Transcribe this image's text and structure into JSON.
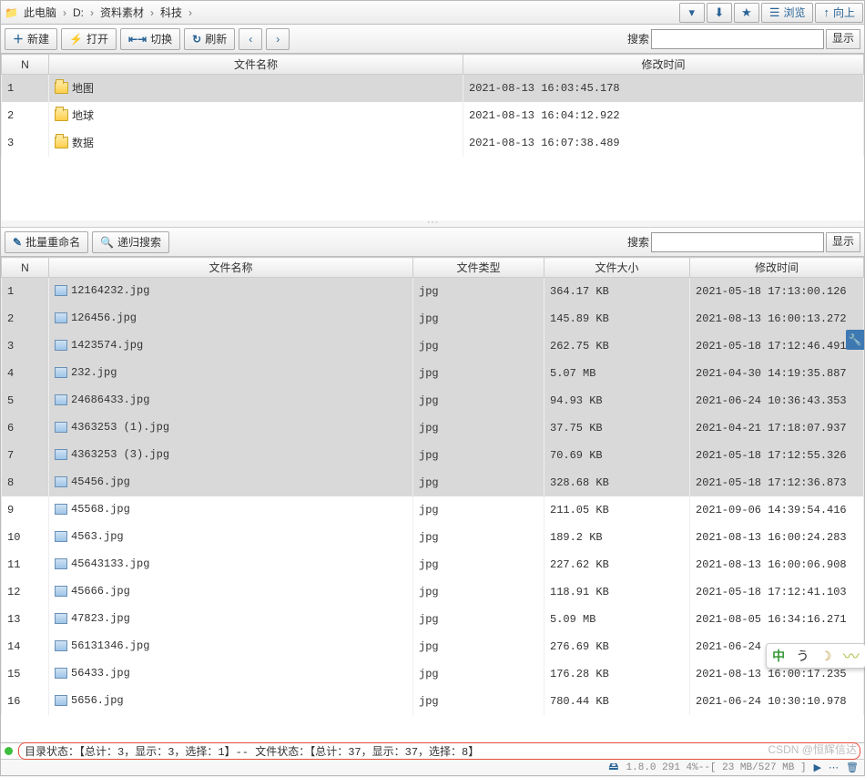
{
  "breadcrumb": {
    "root": "此电脑",
    "items": [
      "D:",
      "资料素材",
      "科技"
    ]
  },
  "nav": {
    "down_icon": "▾",
    "circle_down": "⬇",
    "star": "★",
    "list_icon": "☰",
    "browse": "浏览",
    "up_icon": "↑",
    "up": "向上"
  },
  "toolbar1": {
    "new_icon": "＋",
    "new": "新建",
    "open_icon": "⚡",
    "open": "打开",
    "switch_icon": "⇤⇥",
    "switch": "切换",
    "refresh_icon": "↻",
    "refresh": "刷新",
    "prev": "‹",
    "next": "›",
    "search_label": "搜索",
    "display": "显示"
  },
  "upper": {
    "cols": {
      "n": "N",
      "name": "文件名称",
      "time": "修改时间"
    },
    "rows": [
      {
        "n": "1",
        "name": "地图",
        "time": "2021-08-13 16:03:45.178",
        "sel": true
      },
      {
        "n": "2",
        "name": "地球",
        "time": "2021-08-13 16:04:12.922",
        "sel": false
      },
      {
        "n": "3",
        "name": "数据",
        "time": "2021-08-13 16:07:38.489",
        "sel": false
      }
    ]
  },
  "toolbar2": {
    "rename_icon": "✎",
    "rename": "批量重命名",
    "rsearch_icon": "🔍",
    "rsearch": "递归搜索",
    "search_label": "搜索",
    "display": "显示"
  },
  "lower": {
    "cols": {
      "n": "N",
      "name": "文件名称",
      "type": "文件类型",
      "size": "文件大小",
      "time": "修改时间"
    },
    "rows": [
      {
        "n": "1",
        "name": "12164232.jpg",
        "type": "jpg",
        "size": "364.17 KB",
        "time": "2021-05-18 17:13:00.126",
        "sel": true
      },
      {
        "n": "2",
        "name": "126456.jpg",
        "type": "jpg",
        "size": "145.89 KB",
        "time": "2021-08-13 16:00:13.272",
        "sel": true
      },
      {
        "n": "3",
        "name": "1423574.jpg",
        "type": "jpg",
        "size": "262.75 KB",
        "time": "2021-05-18 17:12:46.491",
        "sel": true
      },
      {
        "n": "4",
        "name": "232.jpg",
        "type": "jpg",
        "size": "5.07 MB",
        "time": "2021-04-30 14:19:35.887",
        "sel": true
      },
      {
        "n": "5",
        "name": "24686433.jpg",
        "type": "jpg",
        "size": "94.93 KB",
        "time": "2021-06-24 10:36:43.353",
        "sel": true
      },
      {
        "n": "6",
        "name": "4363253 (1).jpg",
        "type": "jpg",
        "size": "37.75 KB",
        "time": "2021-04-21 17:18:07.937",
        "sel": true
      },
      {
        "n": "7",
        "name": "4363253 (3).jpg",
        "type": "jpg",
        "size": "70.69 KB",
        "time": "2021-05-18 17:12:55.326",
        "sel": true
      },
      {
        "n": "8",
        "name": "45456.jpg",
        "type": "jpg",
        "size": "328.68 KB",
        "time": "2021-05-18 17:12:36.873",
        "sel": true
      },
      {
        "n": "9",
        "name": "45568.jpg",
        "type": "jpg",
        "size": "211.05 KB",
        "time": "2021-09-06 14:39:54.416",
        "sel": false
      },
      {
        "n": "10",
        "name": "4563.jpg",
        "type": "jpg",
        "size": "189.2 KB",
        "time": "2021-08-13 16:00:24.283",
        "sel": false
      },
      {
        "n": "11",
        "name": "45643133.jpg",
        "type": "jpg",
        "size": "227.62 KB",
        "time": "2021-08-13 16:00:06.908",
        "sel": false
      },
      {
        "n": "12",
        "name": "45666.jpg",
        "type": "jpg",
        "size": "118.91 KB",
        "time": "2021-05-18 17:12:41.103",
        "sel": false
      },
      {
        "n": "13",
        "name": "47823.jpg",
        "type": "jpg",
        "size": "5.09 MB",
        "time": "2021-08-05 16:34:16.271",
        "sel": false
      },
      {
        "n": "14",
        "name": "56131346.jpg",
        "type": "jpg",
        "size": "276.69 KB",
        "time": "2021-06-24",
        "sel": false
      },
      {
        "n": "15",
        "name": "56433.jpg",
        "type": "jpg",
        "size": "176.28 KB",
        "time": "2021-08-13 16:00:17.235",
        "sel": false
      },
      {
        "n": "16",
        "name": "5656.jpg",
        "type": "jpg",
        "size": "780.44 KB",
        "time": "2021-06-24 10:30:10.978",
        "sel": false
      }
    ]
  },
  "side_tool": "🔧",
  "status": "目录状态：【总计：3，显示：3，选择：1】-- 文件状态：【总计：37，显示：37，选择：8】",
  "bottom": {
    "disk_icon": "🖴",
    "info": "1.8.0 291  4%--[ 23 MB/527 MB ]",
    "play": "▶",
    "more": "⋯",
    "trash": "🗑"
  },
  "watermark": "CSDN @恒辉信达",
  "ime": {
    "zh": "中",
    "comma": "う",
    "moon": "☽"
  }
}
